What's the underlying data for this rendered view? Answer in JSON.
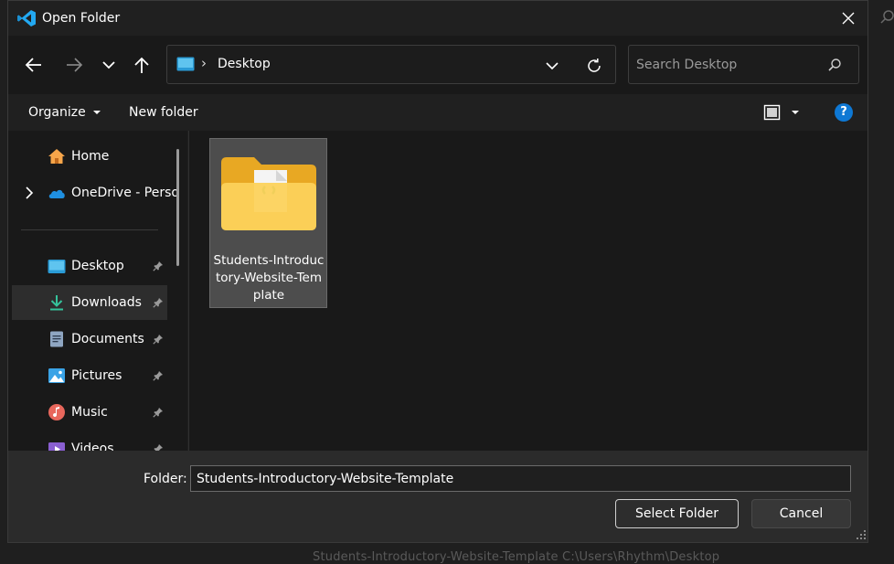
{
  "window": {
    "title": "Open Folder"
  },
  "nav": {
    "address_path": "Desktop",
    "address_separator": "›"
  },
  "search": {
    "placeholder": "Search Desktop"
  },
  "toolbar": {
    "organize_label": "Organize",
    "new_folder_label": "New folder",
    "help_label": "?"
  },
  "sidebar": {
    "items": [
      {
        "label": "Home",
        "icon": "home-icon",
        "pinned": false
      },
      {
        "label": "OneDrive - Perso",
        "icon": "onedrive-cloud-icon",
        "pinned": false,
        "expandable": true
      },
      {
        "label": "Desktop",
        "icon": "desktop-icon",
        "pinned": true
      },
      {
        "label": "Downloads",
        "icon": "downloads-icon",
        "pinned": true,
        "selected": true
      },
      {
        "label": "Documents",
        "icon": "documents-icon",
        "pinned": true
      },
      {
        "label": "Pictures",
        "icon": "pictures-icon",
        "pinned": true
      },
      {
        "label": "Music",
        "icon": "music-icon",
        "pinned": true
      },
      {
        "label": "Videos",
        "icon": "videos-icon",
        "pinned": true
      }
    ]
  },
  "content": {
    "items": [
      {
        "name": "Students-Introductory-Website-Template",
        "type": "folder",
        "selected": true
      }
    ]
  },
  "footer": {
    "folder_label": "Folder:",
    "folder_value": "Students-Introductory-Website-Template",
    "select_label": "Select Folder",
    "cancel_label": "Cancel"
  },
  "background": {
    "status_text": "Students-Introductory-Website-Template    C:\\Users\\Rhythm\\Desktop"
  },
  "colors": {
    "accent": "#0e78d4",
    "folder": "#f8c94a",
    "selection": "#4d4d4d",
    "logo": "#23a9f2"
  }
}
